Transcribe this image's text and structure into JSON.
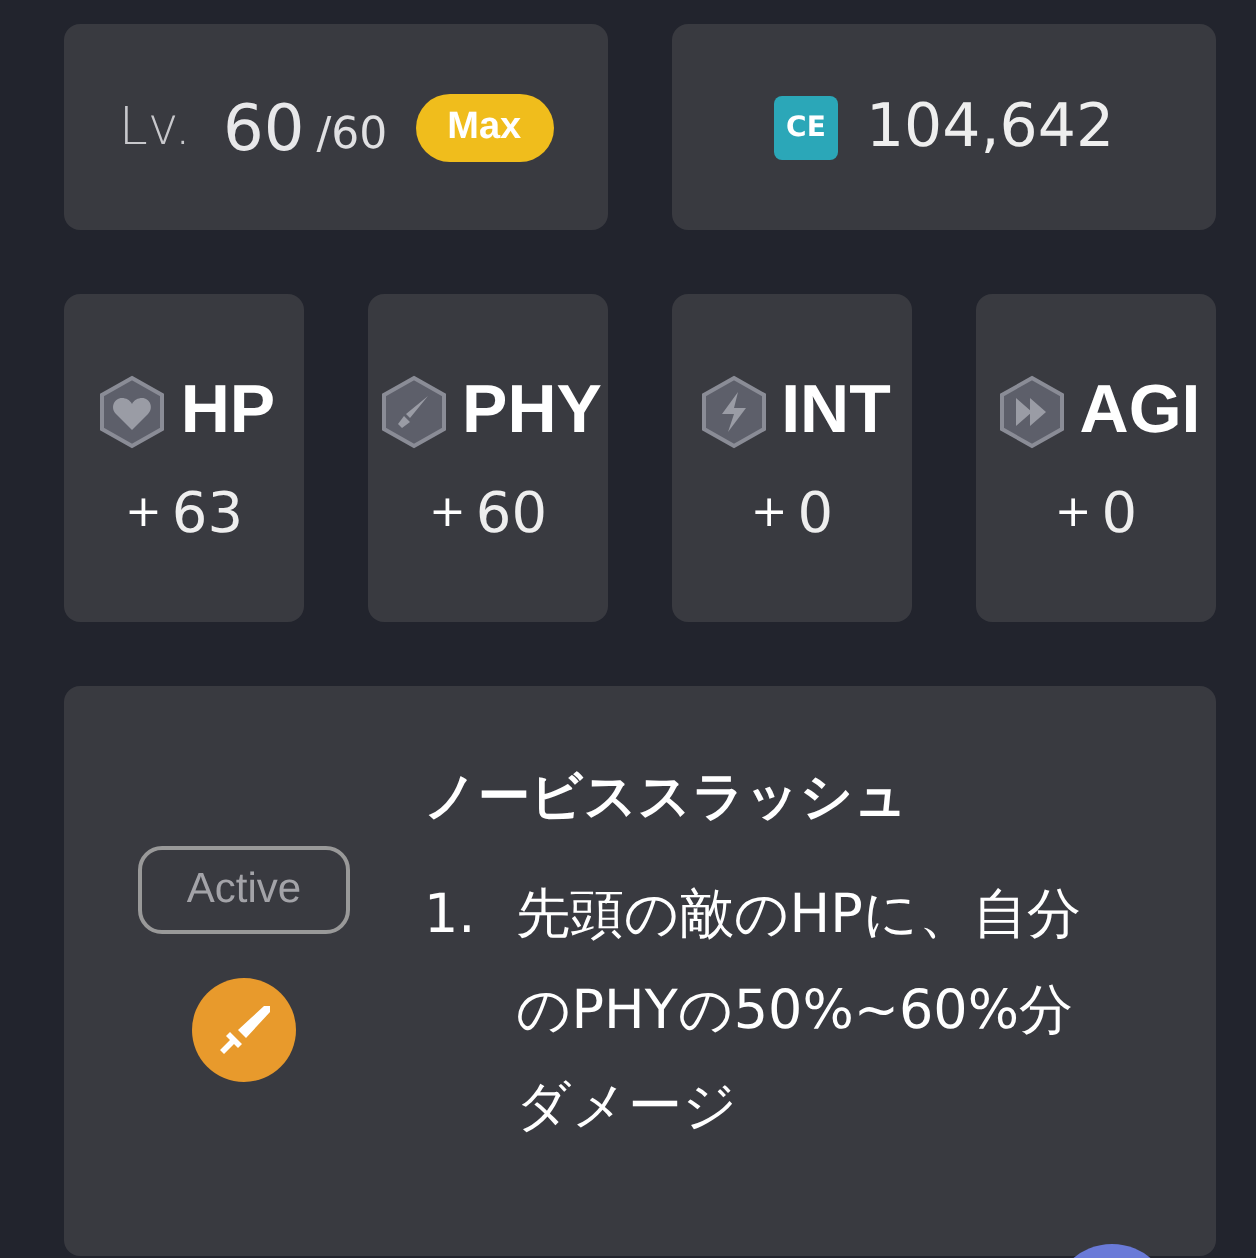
{
  "level": {
    "label": "Lv.",
    "current": "60",
    "max": "/60",
    "badge": "Max"
  },
  "power": {
    "icon_text": "CE",
    "value": "104,642"
  },
  "stats": [
    {
      "kind": "heart",
      "name": "HP",
      "bonus": "+",
      "value": "63"
    },
    {
      "kind": "sword",
      "name": "PHY",
      "bonus": "+",
      "value": "60"
    },
    {
      "kind": "bolt",
      "name": "INT",
      "bonus": "+",
      "value": "0"
    },
    {
      "kind": "arrows",
      "name": "AGI",
      "bonus": "+",
      "value": "0"
    }
  ],
  "skill": {
    "tag": "Active",
    "name": "ノービススラッシュ",
    "effects": [
      {
        "number": "1.",
        "text": "先頭の敵のHPに、自分のPHYの50%~60%分ダメージ"
      }
    ]
  }
}
